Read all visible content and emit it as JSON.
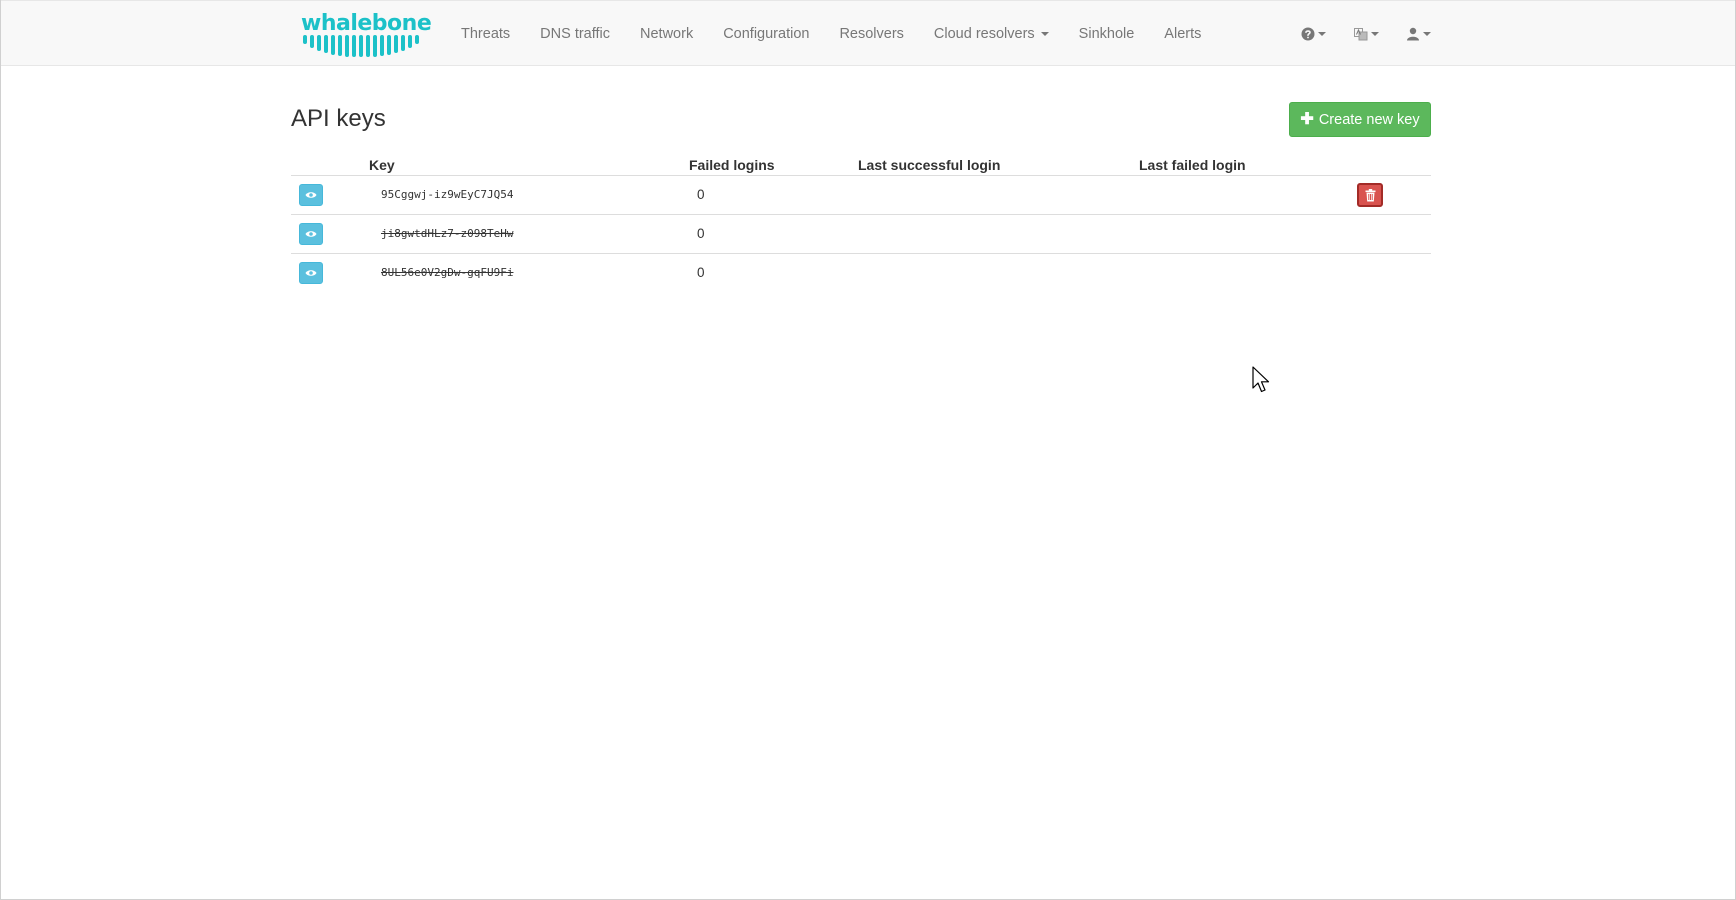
{
  "brand": {
    "name": "whalebone",
    "color": "#1cc1c8"
  },
  "nav": {
    "links": [
      {
        "label": "Threats"
      },
      {
        "label": "DNS traffic"
      },
      {
        "label": "Network"
      },
      {
        "label": "Configuration"
      },
      {
        "label": "Resolvers"
      },
      {
        "label": "Cloud resolvers",
        "dropdown": true
      },
      {
        "label": "Sinkhole"
      },
      {
        "label": "Alerts"
      }
    ],
    "right_icons": [
      "question-circle-icon",
      "language-icon",
      "user-icon"
    ]
  },
  "page": {
    "title": "API keys",
    "create_button": "Create new key"
  },
  "table": {
    "columns": {
      "key": "Key",
      "failed_logins": "Failed logins",
      "last_successful_login": "Last successful login",
      "last_failed_login": "Last failed login"
    },
    "rows": [
      {
        "key": "95Cggwj-iz9wEyC7JQ54",
        "failed_logins": "0",
        "last_successful_login": "",
        "last_failed_login": "",
        "revoked": false
      },
      {
        "key": "ji8gwtdHLz7-z098TeHw",
        "failed_logins": "0",
        "last_successful_login": "",
        "last_failed_login": "",
        "revoked": true
      },
      {
        "key": "8UL56e0V2gDw-gqFU9Fi",
        "failed_logins": "0",
        "last_successful_login": "",
        "last_failed_login": "",
        "revoked": true
      }
    ]
  },
  "colors": {
    "success": "#5cb85c",
    "info": "#5bc0de",
    "danger": "#d9534f"
  }
}
